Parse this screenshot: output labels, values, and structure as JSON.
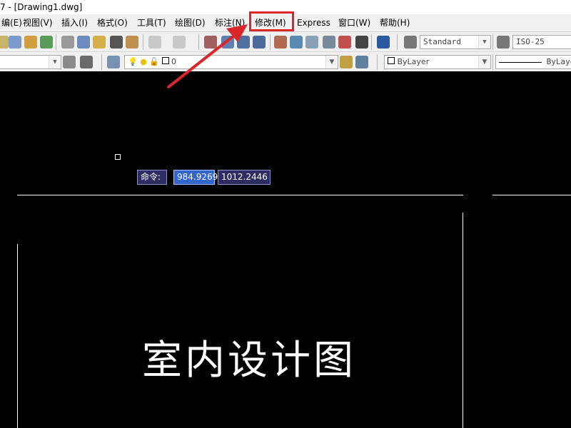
{
  "window": {
    "title": "7 - [Drawing1.dwg]"
  },
  "menu": {
    "items": [
      {
        "label": "编(E)"
      },
      {
        "label": "视图(V)"
      },
      {
        "label": "插入(I)"
      },
      {
        "label": "格式(O)"
      },
      {
        "label": "工具(T)"
      },
      {
        "label": "绘图(D)"
      },
      {
        "label": "标注(N)"
      },
      {
        "label": "修改(M)"
      },
      {
        "label": "Express"
      },
      {
        "label": "窗口(W)"
      },
      {
        "label": "帮助(H)"
      }
    ],
    "highlighted": "修改(M)"
  },
  "toolbar": {
    "text_style": "Standard",
    "dim_style": "ISO-25",
    "layer_name": "0",
    "color_control": "ByLayer",
    "linetype_control": "ByLayer"
  },
  "dynamic_input": {
    "prompt": "命令:",
    "x_value": "984.9269",
    "y_value": "1012.2446"
  },
  "drawing": {
    "title_text": "室内设计图"
  },
  "colors": {
    "annotation_red": "#d9262b",
    "canvas_bg": "#000000",
    "dyn_input_bg": "#2d2d63",
    "dyn_selected_bg": "#3366cc"
  }
}
